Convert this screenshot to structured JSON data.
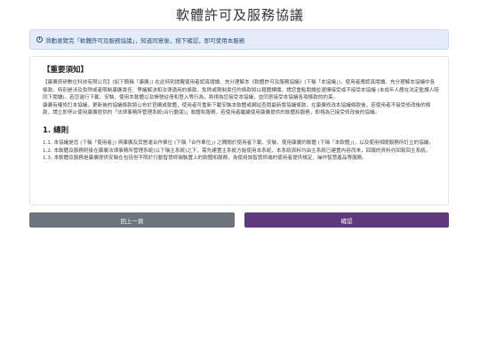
{
  "page": {
    "title": "軟體許可及服務協議"
  },
  "notice": {
    "icon": "info-circle-icon",
    "text": "滑動瀏覽完「軟體許可及服務協議」，知道同意後，按下確認，即可使用本服務"
  },
  "terms": {
    "notice_heading": "【重要須知】",
    "notice_paragraphs": [
      "【康廣資研數位科技有限公司】(如下簡稱「康廣」) 在此特別提醒使用者認真閱讀、充分理解本《軟體許可及服務協議》(下稱「本協議」)。使用者應認真閱讀、充分理解本協議中各條款，特別是涉及免除或者限制康廣責任、爭議解決和法律適用的條款。免除或限制責任的條款將以粗體標識，請您重點閱讀並選擇接受或不接受本協議 (未成年人應在法定監護人陪同下閱讀)。若您進行下載、安裝、使用本軟體以及帳號註冊和登入等行為，將視為您接受本協議，並同意接受本協議各項條款的約束。",
      "康廣有權修訂本協議，更新後的協議條款將公布於官網或軟體，使用者可重新下載安裝本軟體或網站查閱最新版協議條款。在康廣修改本協議條款後，若使用者不接受修改後的條款，請立即停止使用康廣提供的「法律事務所管理系統(合行動版)」軟體和服務，若使用者繼續使用康廣提供的軟體和服務，即視為已接受修改後的協議。"
    ],
    "clause_heading": "1. 總則",
    "clause_paragraphs": [
      "1.1. 本協議是您 (下稱「使用者」) 與康廣及其營運合作單位 (下稱「合作單位」) 之間關於使用者下載、安裝、使用康廣的軟體 (下稱「本軟體」)，以及使用相關服務所訂立的協議。",
      "1.2. 本軟體及服務附掛在康廣法律事務所管理系統(以下稱主系統)之下，需先建置主系統方能使用本系統，本系統資料均由主系統已建置內容而來，回報的資料亦回寫回主系統。",
      "1.3. 本軟體及服務是康廣提供安裝在包括但不限於行動智慧終端裝置上的軟體和服務，為使用該智慧終端的使用者提供規定、操作智慧產品等服務。"
    ]
  },
  "buttons": {
    "prev_label": "回上一頁",
    "confirm_label": "確認"
  },
  "colors": {
    "notice_bg": "#e3ecf8",
    "prev_button": "#6c757d",
    "confirm_button": "#5e3a7d"
  }
}
